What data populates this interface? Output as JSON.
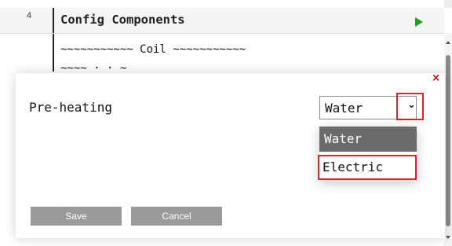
{
  "editor": {
    "cell_number": "4",
    "cell_title": "Config Components",
    "code_line": "~~~~~~~~~~~ Coil ~~~~~~~~~~~",
    "code_line_partial": "~~~~ · · ~"
  },
  "dialog": {
    "close_glyph": "×",
    "field_label": "Pre-heating",
    "select_value": "Water",
    "chevron_glyph": "⌄",
    "options": [
      {
        "label": "Water"
      },
      {
        "label": "Electric"
      }
    ],
    "save_label": "Save",
    "cancel_label": "Cancel"
  },
  "icons": {
    "run": "run-cell-icon",
    "close": "close-icon",
    "dropdown": "chevron-down-icon"
  },
  "colors": {
    "run_green": "#20a020",
    "highlight_red": "#e0202a",
    "selected_option_bg": "#6b6b6b",
    "button_gray": "#9a9a9a"
  }
}
